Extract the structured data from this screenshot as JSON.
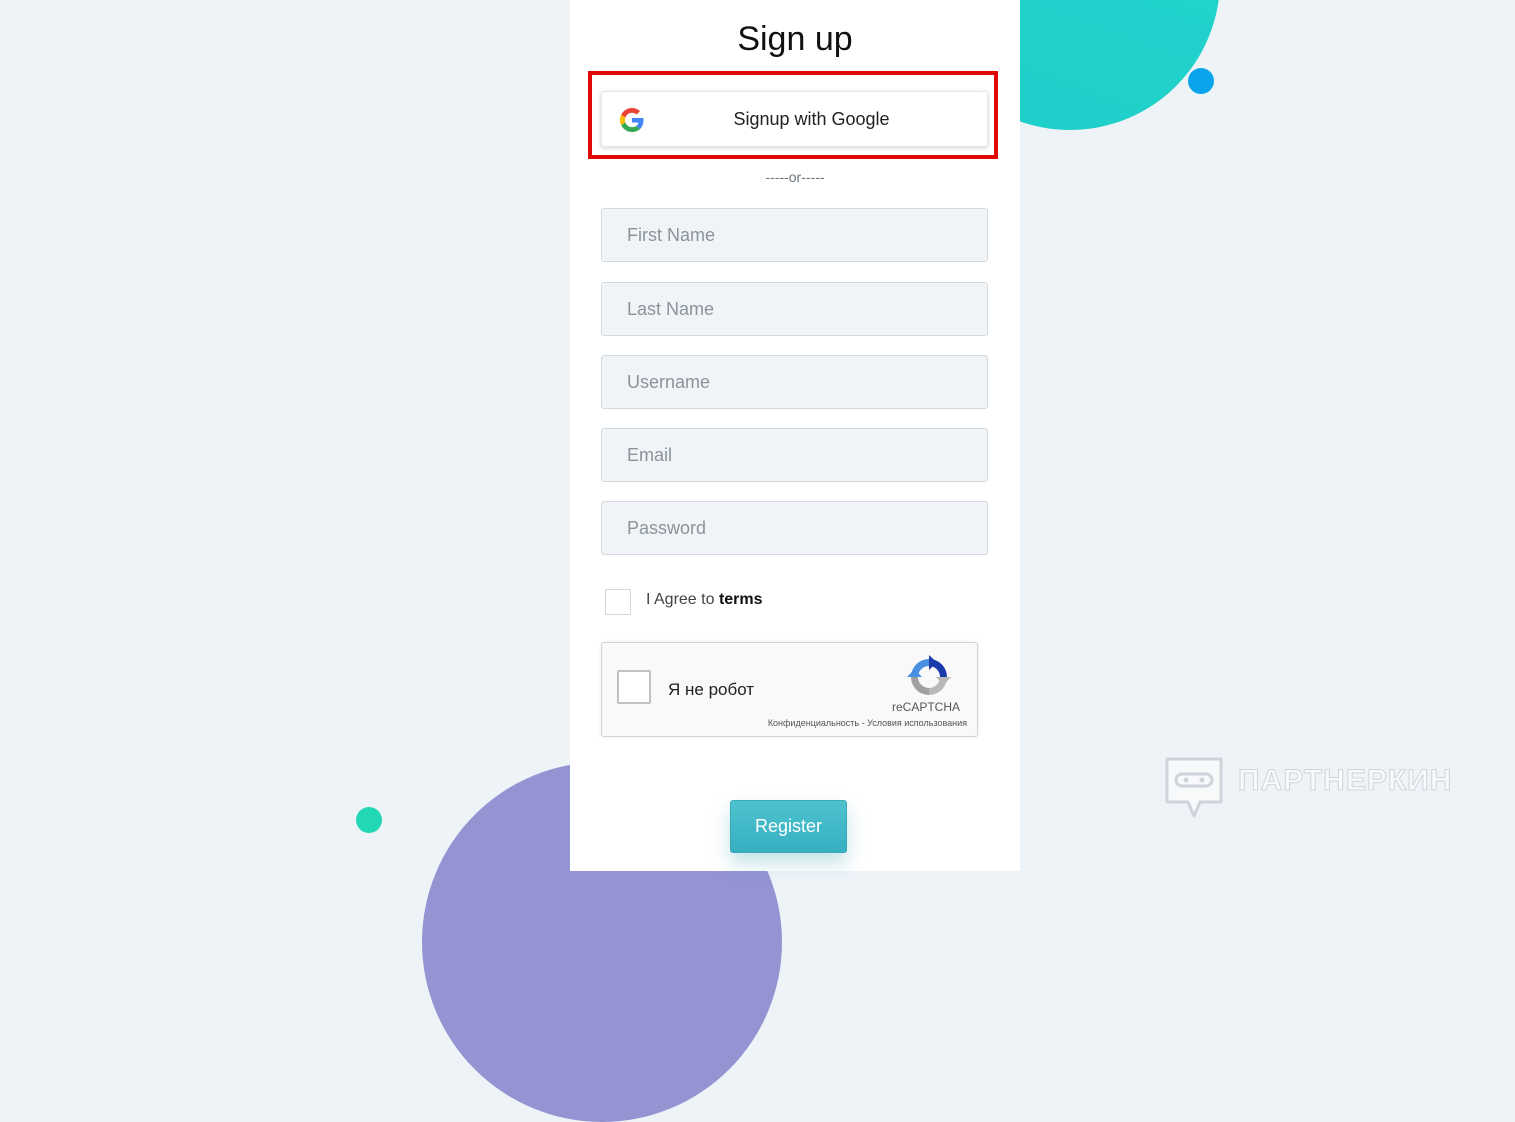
{
  "form": {
    "title": "Sign up",
    "google_button_label": "Signup with Google",
    "separator": "-----or-----",
    "fields": {
      "first_name": {
        "placeholder": "First Name",
        "value": ""
      },
      "last_name": {
        "placeholder": "Last Name",
        "value": ""
      },
      "username": {
        "placeholder": "Username",
        "value": ""
      },
      "email": {
        "placeholder": "Email",
        "value": ""
      },
      "password": {
        "placeholder": "Password",
        "value": ""
      }
    },
    "agree": {
      "prefix": "I Agree to ",
      "link": "terms",
      "checked": false
    },
    "register_label": "Register"
  },
  "recaptcha": {
    "label": "Я не робот",
    "brand": "reCAPTCHA",
    "links": "Конфиденциальность - Условия использования",
    "checked": false
  },
  "watermark": {
    "text": "ПАРТНЕРКИН"
  },
  "icons": {
    "google": "google-g-icon",
    "recaptcha": "recaptcha-logo-icon",
    "watermark": "chat-bubble-icon"
  },
  "colors": {
    "background": "#eef3f8",
    "highlight_border": "#e10808",
    "register_button": "#3fb8c6",
    "teal_blob": "#21d6cd",
    "purple_blob": "#9594d3",
    "blue_dot": "#0aa4ec",
    "green_dot": "#22d8b4"
  }
}
